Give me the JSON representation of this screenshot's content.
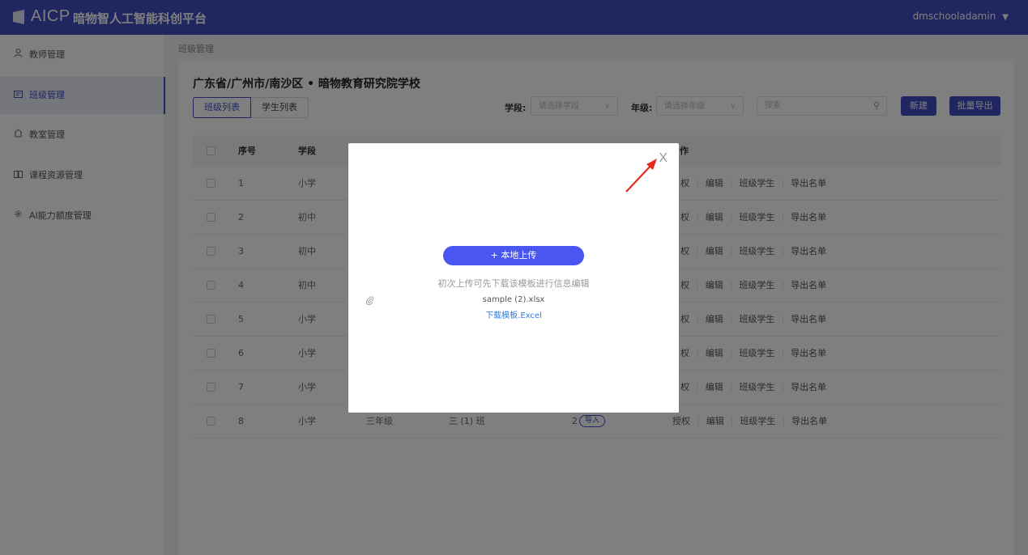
{
  "header": {
    "brand": "AICP",
    "brand_sub": "暗物智人工智能科创平台",
    "user": "dmschooladamin",
    "caret": "▼"
  },
  "sidebar": {
    "items": [
      {
        "icon": "user-icon",
        "glyph": "Ã",
        "label": "教师管理"
      },
      {
        "icon": "class-icon",
        "glyph": "▭",
        "label": "班级管理"
      },
      {
        "icon": "home-icon",
        "glyph": "⌂",
        "label": "教室管理"
      },
      {
        "icon": "book-icon",
        "glyph": "▣",
        "label": "课程资源管理"
      },
      {
        "icon": "gear-icon",
        "glyph": "⚙",
        "label": "AI能力额度管理"
      }
    ]
  },
  "breadcrumb": "班级管理",
  "main": {
    "school": "广东省/广州市/南沙区 • 暗物教育研究院学校",
    "tabs": [
      "班级列表",
      "学生列表"
    ],
    "filters": {
      "stage_label": "学段:",
      "stage_placeholder": "请选择学段",
      "grade_label": "年级:",
      "grade_placeholder": "请选择年级",
      "search_placeholder": "搜索"
    },
    "buttons": {
      "new": "新建",
      "export": "批量导出"
    },
    "columns": {
      "index": "序号",
      "stage": "学段",
      "ops": "作"
    },
    "rows": [
      {
        "index": "1",
        "stage": "小学"
      },
      {
        "index": "2",
        "stage": "初中"
      },
      {
        "index": "3",
        "stage": "初中"
      },
      {
        "index": "4",
        "stage": "初中"
      },
      {
        "index": "5",
        "stage": "小学"
      },
      {
        "index": "6",
        "stage": "小学"
      },
      {
        "index": "7",
        "stage": "小学"
      },
      {
        "index": "8",
        "stage": "小学",
        "grade": "三年级",
        "class": "三 (1) 班",
        "count": "2",
        "badge": "导入"
      }
    ],
    "ops_partial": [
      "授权",
      "编辑",
      "班级学生",
      "导出名单"
    ],
    "ops_partial_first": "权",
    "ops_full_first": "授权"
  },
  "modal": {
    "close": "X",
    "upload": "+ 本地上传",
    "hint": "初次上传可先下载该模板进行信息编辑",
    "file_name": "sample (2).xlsx",
    "download": "下载模板.Excel"
  },
  "colors": {
    "primary": "#3f4dc1",
    "upload": "#4a56f0",
    "link": "#2b7de9",
    "arrow": "#e62b1e"
  }
}
